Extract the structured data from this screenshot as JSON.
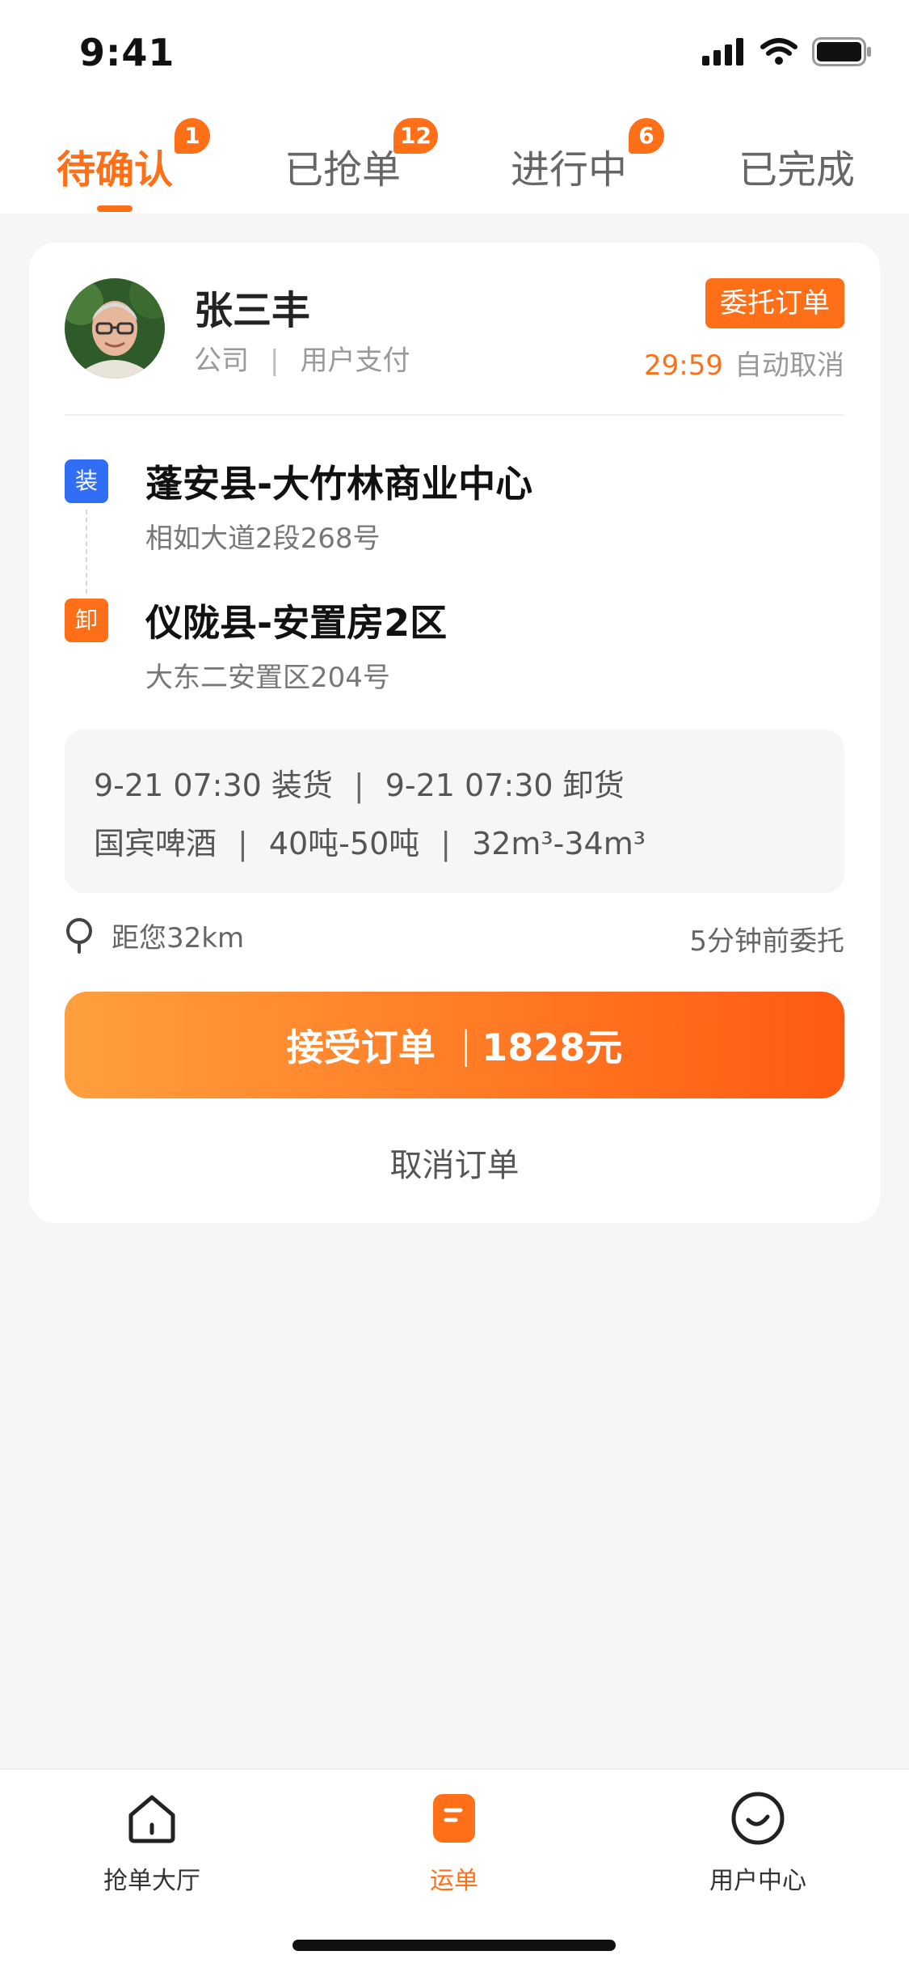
{
  "status_bar": {
    "time": "9:41"
  },
  "tabs": [
    {
      "label": "待确认",
      "badge": "1",
      "active": true
    },
    {
      "label": "已抢单",
      "badge": "12",
      "active": false
    },
    {
      "label": "进行中",
      "badge": "6",
      "active": false
    },
    {
      "label": "已完成",
      "badge": "",
      "active": false
    }
  ],
  "order": {
    "customer_name": "张三丰",
    "company": "公司",
    "payment": "用户支付",
    "tag": "委托订单",
    "countdown": "29:59",
    "countdown_suffix": "自动取消",
    "load": {
      "badge": "装",
      "title": "蓬安县-大竹林商业中心",
      "address": "相如大道2段268号"
    },
    "unload": {
      "badge": "卸",
      "title": "仪陇县-安置房2区",
      "address": "大东二安置区204号"
    },
    "info": {
      "load_time": "9-21 07:30 装货",
      "unload_time": "9-21 07:30 卸货",
      "cargo": "国宾啤酒",
      "weight": "40吨-50吨",
      "volume": "32m³-34m³"
    },
    "distance": "距您32km",
    "posted": "5分钟前委托",
    "accept_label": "接受订单",
    "accept_price": "1828元",
    "cancel_label": "取消订单"
  },
  "bottom_nav": [
    {
      "label": "抢单大厅",
      "icon": "home-icon",
      "active": false
    },
    {
      "label": "运单",
      "icon": "waybill-icon",
      "active": true
    },
    {
      "label": "用户中心",
      "icon": "smile-icon",
      "active": false
    }
  ],
  "colors": {
    "accent": "#ff6f17",
    "load_badge": "#2f6ef5",
    "background": "#f6f6f6"
  }
}
